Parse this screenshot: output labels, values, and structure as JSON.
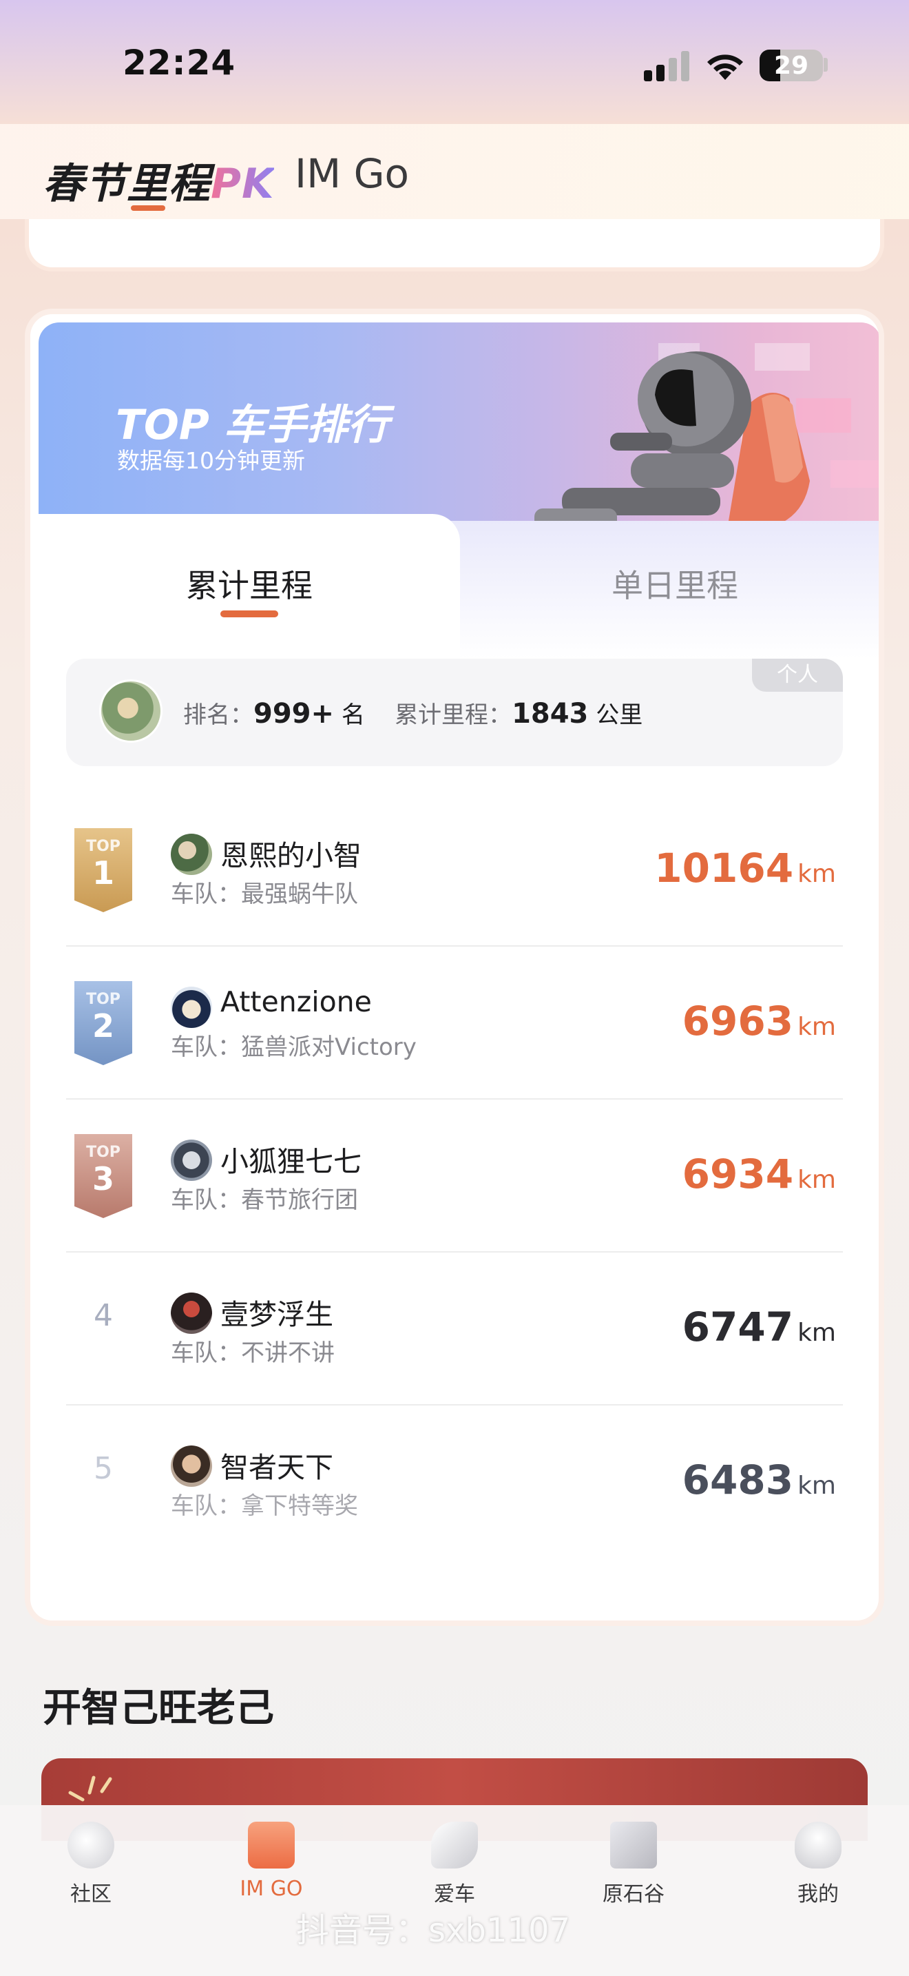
{
  "status_bar": {
    "time": "22:24",
    "battery": "29"
  },
  "header": {
    "tab_brand": "春节里程",
    "tab_brand_pk": "PK",
    "tab_imgo": "IM Go"
  },
  "leaderboard": {
    "banner_title": "TOP 车手排行",
    "banner_subtitle": "数据每10分钟更新",
    "tabs": [
      {
        "label": "累计里程"
      },
      {
        "label": "单日里程"
      }
    ],
    "me": {
      "tag": "个人",
      "rank_label": "排名：",
      "rank_value": "999+",
      "rank_unit": "名",
      "mileage_label": "累计里程：",
      "mileage_value": "1843",
      "mileage_unit": "公里"
    },
    "badge_top_text": "TOP",
    "team_prefix": "车队：",
    "unit": "km",
    "rows": [
      {
        "rank": "1",
        "name": "恩熙的小智",
        "team": "最强蜗牛队",
        "distance": "10164"
      },
      {
        "rank": "2",
        "name": "Attenzione",
        "team": "猛兽派对Victory",
        "distance": "6963"
      },
      {
        "rank": "3",
        "name": "小狐狸七七",
        "team": "春节旅行团",
        "distance": "6934"
      },
      {
        "rank": "4",
        "name": "壹梦浮生",
        "team": "不讲不讲",
        "distance": "6747"
      },
      {
        "rank": "5",
        "name": "智者天下",
        "team": "拿下特等奖",
        "distance": "6483"
      }
    ]
  },
  "section": {
    "title": "开智己旺老己"
  },
  "bottom_nav": [
    {
      "label": "社区",
      "icon": "community-icon"
    },
    {
      "label": "IM GO",
      "icon": "imgo-icon",
      "active": true
    },
    {
      "label": "爱车",
      "icon": "car-icon"
    },
    {
      "label": "原石谷",
      "icon": "stone-icon"
    },
    {
      "label": "我的",
      "icon": "profile-icon"
    }
  ],
  "watermark": "抖音号：sxb1107",
  "colors": {
    "accent": "#e36b3e",
    "gold": "#d9b26c",
    "silver": "#8da9d3",
    "bronze": "#c98f82"
  }
}
